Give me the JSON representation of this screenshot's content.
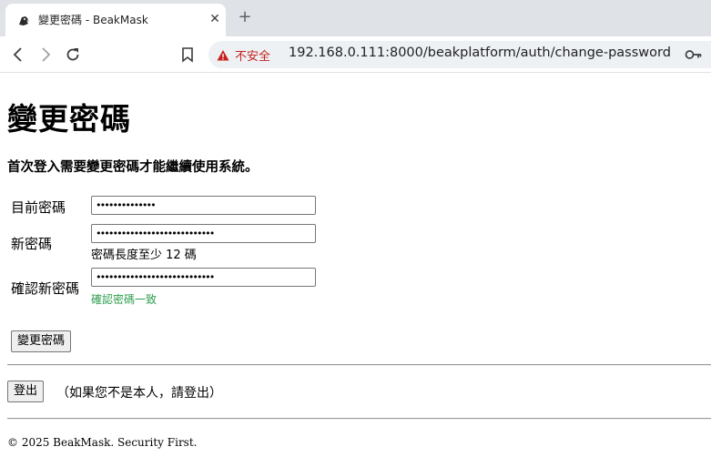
{
  "browser": {
    "tab_title": "變更密碼 - BeakMask",
    "tab_close_glyph": "✕",
    "new_tab_glyph": "+",
    "security_label": "不安全",
    "url": "192.168.0.111:8000/beakplatform/auth/change-password",
    "icons": {
      "favicon": "beakmask-favicon",
      "back": "back-arrow-icon",
      "forward": "forward-arrow-icon",
      "reload": "reload-icon",
      "bookmark": "bookmark-icon",
      "warning": "warning-triangle-icon",
      "key": "key-icon"
    },
    "colors": {
      "tabbar_bg": "#dfe3e7",
      "omnibox_bg": "#eef1f4",
      "insecure_red": "#c5221f",
      "success_green": "#2e9e4f"
    }
  },
  "page": {
    "title": "變更密碼",
    "notice": "首次登入需要變更密碼才能繼續使用系統。",
    "form": {
      "current_password_label": "目前密碼",
      "current_password_value": "••••••••••••••",
      "new_password_label": "新密碼",
      "new_password_value": "••••••••••••••••••••••••••••",
      "new_password_hint": "密碼長度至少 12 碼",
      "confirm_password_label": "確認新密碼",
      "confirm_password_value": "••••••••••••••••••••••••••••",
      "confirm_password_status": "確認密碼一致",
      "submit_label": "變更密碼"
    },
    "logout": {
      "button_label": "登出",
      "note": "（如果您不是本人，請登出）"
    },
    "footer": "© 2025 BeakMask. Security First."
  }
}
